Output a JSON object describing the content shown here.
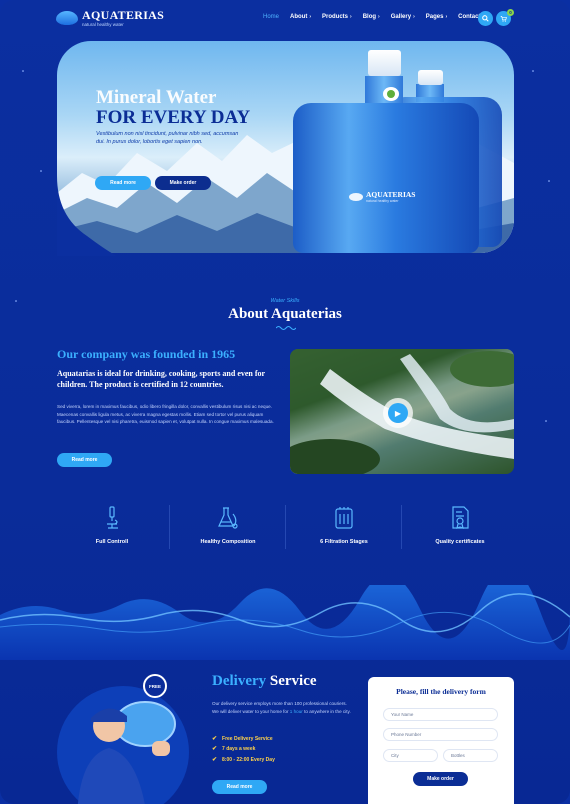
{
  "colors": {
    "background": "#0a2fa3",
    "accent": "#2fa8f5",
    "accent_text": "#3bb0ff",
    "dark_button": "#0c2d8f",
    "badge": "#8bd64a",
    "check": "#ffd34a"
  },
  "header": {
    "logo_title": "AQUATERIAS",
    "logo_subtitle": "natural healthy water",
    "nav": [
      {
        "label": "Home",
        "has_caret": false
      },
      {
        "label": "About",
        "has_caret": true
      },
      {
        "label": "Products",
        "has_caret": true
      },
      {
        "label": "Blog",
        "has_caret": true
      },
      {
        "label": "Gallery",
        "has_caret": true
      },
      {
        "label": "Pages",
        "has_caret": true
      },
      {
        "label": "Contacts",
        "has_caret": false
      }
    ],
    "search_icon": "search-icon",
    "cart_icon": "cart-icon",
    "cart_count": "0"
  },
  "hero": {
    "title_line1": "Mineral Water",
    "title_line2": "FOR EVERY DAY",
    "description": "Vestibulum non nisl tincidunt, pulvinar nibh sed, accumsan dui. In purus dolor, lobortis eget sapien non.",
    "read_more": "Read more",
    "make_order": "Make order",
    "bottle_label": "AQUATERIAS",
    "bottle_label_sub": "natural healthy water"
  },
  "about": {
    "kicker": "Water Skills",
    "title": "About Aquaterias",
    "heading": "Our company was founded in 1965",
    "lead": "Aquatarias is ideal for drinking, cooking, sports and even for children. The product is certified in 12 countries.",
    "body": "Sed viverra, lorem in maximus faucibus, odio libero fringilla dolor, convallis vestibulum risus nisi ac neque. Maecenas convallis ligula metus, ac viverra magna egestas mollis. Etiam sed tortor vel purus aliquam faucibus. Pellentesque vel nisi pharetra, euismod sapien et, volutpat nulla. In congue maximus malesuada.",
    "read_more": "Read more",
    "play_icon": "play-icon"
  },
  "features": [
    {
      "label": "Full Controll",
      "icon": "microscope-icon"
    },
    {
      "label": "Healthy Composition",
      "icon": "flask-icon"
    },
    {
      "label": "6 Filtration Stages",
      "icon": "filter-icon"
    },
    {
      "label": "Quality certificates",
      "icon": "certificate-icon"
    }
  ],
  "delivery": {
    "title_accent": "Delivery",
    "title_rest": "Service",
    "body_before": "Our delivery service employs more than 100 professional couriers. We will deliver water to your home for",
    "body_highlight": "1 hour",
    "body_after": "to anywhere in the city.",
    "checks": [
      "Free Delivery Service",
      "7 days a week",
      "8:00 - 22:00 Every Day"
    ],
    "read_more": "Read more",
    "free_badge": "FREE"
  },
  "form": {
    "title": "Please, fill the delivery form",
    "name_placeholder": "Your Name",
    "phone_placeholder": "Phone Number",
    "city_placeholder": "City",
    "bottles_placeholder": "Bottles",
    "submit": "Make order"
  }
}
